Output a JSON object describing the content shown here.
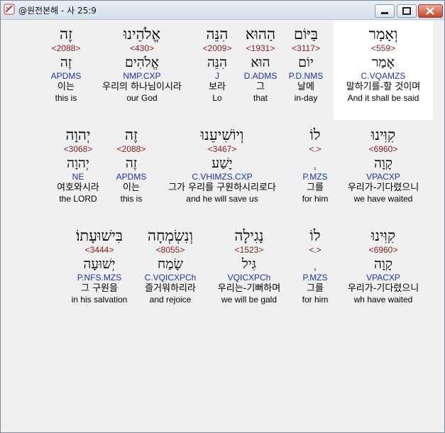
{
  "window": {
    "title": "@원전본해 - 사 25:9"
  },
  "colors": {
    "strongs": "#8b1a1a",
    "parse": "#1b2fc0",
    "highlight": "#ffffff"
  },
  "rows": [
    {
      "words": [
        {
          "heb": "וְאָמַר",
          "num": "<559>",
          "lemma": "אָמַר",
          "parse": "C.VQAMZS",
          "ko": "말하기를-할 것이며",
          "en": "And it shall be said"
        },
        {
          "heb": "בַּיּוֹם",
          "num": "<3117>",
          "lemma": "יוֹם",
          "parse": "P.D.NMS",
          "ko": "날에",
          "en": "in-day"
        },
        {
          "heb": "הַהוּא",
          "num": "<1931>",
          "lemma": "הוּא",
          "parse": "D.ADMS",
          "ko": "그",
          "en": "that"
        },
        {
          "heb": "הִנֵּה",
          "num": "<2009>",
          "lemma": "הִנֵּה",
          "parse": "J",
          "ko": "보라",
          "en": "Lo"
        },
        {
          "heb": "אֱלֹהֵינוּ",
          "num": "<430>",
          "lemma": "אֱלֹהִים",
          "parse": "NMP.CXP",
          "ko": "우리의 하나님이시라",
          "en": "our God"
        },
        {
          "heb": "זֶה",
          "num": "<2088>",
          "lemma": "זֶה",
          "parse": "APDMS",
          "ko": "이는",
          "en": "this is"
        }
      ]
    },
    {
      "words": [
        {
          "heb": "קִוִּינוּ",
          "num": "<6960>",
          "lemma": "קָוָה",
          "parse": "VPACXP",
          "ko": "우리가-기다렸으니",
          "en": "we have waited"
        },
        {
          "heb": "לוֹ",
          "num": "<.>",
          "lemma": "ְ",
          "parse": "P.MZS",
          "ko": "그를",
          "en": "for him"
        },
        {
          "heb": "וְיוֹשִׁיעֵנוּ",
          "num": "<3467>",
          "lemma": "יָשַׁע",
          "parse": "C.VHIMZS.CXP",
          "ko": "그가 우리를 구원하시리로다",
          "en": "and he will save us"
        },
        {
          "heb": "זֶה",
          "num": "<2088>",
          "lemma": "זֶה",
          "parse": "APDMS",
          "ko": "이는",
          "en": "this is"
        },
        {
          "heb": "יְהוָה",
          "num": "<3068>",
          "lemma": "יְהוָה",
          "parse": "NE",
          "ko": "여호와시라",
          "en": "the LORD"
        }
      ]
    },
    {
      "words": [
        {
          "heb": "קִוִּינוּ",
          "num": "<6960>",
          "lemma": "קָוָה",
          "parse": "VPACXP",
          "ko": "우리가-기다렸으니",
          "en": "wh have waited"
        },
        {
          "heb": "לוֹ",
          "num": "<.>",
          "lemma": "ְ",
          "parse": "P.MZS",
          "ko": "그를",
          "en": "for him"
        },
        {
          "heb": "נָגִילָה",
          "num": "<1523>",
          "lemma": "גִּיל",
          "parse": "VQICXPCh",
          "ko": "우리는-기뻐하며",
          "en": "we will be gald"
        },
        {
          "heb": "וְנִשְׂמְחָה",
          "num": "<8055>",
          "lemma": "שָׂמַח",
          "parse": "C.VQICXPCh",
          "ko": "즐거워하리라",
          "en": "and rejoice"
        },
        {
          "heb": "בִּישׁוּעָתוֹ׃",
          "num": "<3444>",
          "lemma": "יְשׁוּעָה",
          "parse": "P.NFS.MZS",
          "ko": "그 구원을",
          "en": "in his salvation"
        }
      ]
    }
  ]
}
